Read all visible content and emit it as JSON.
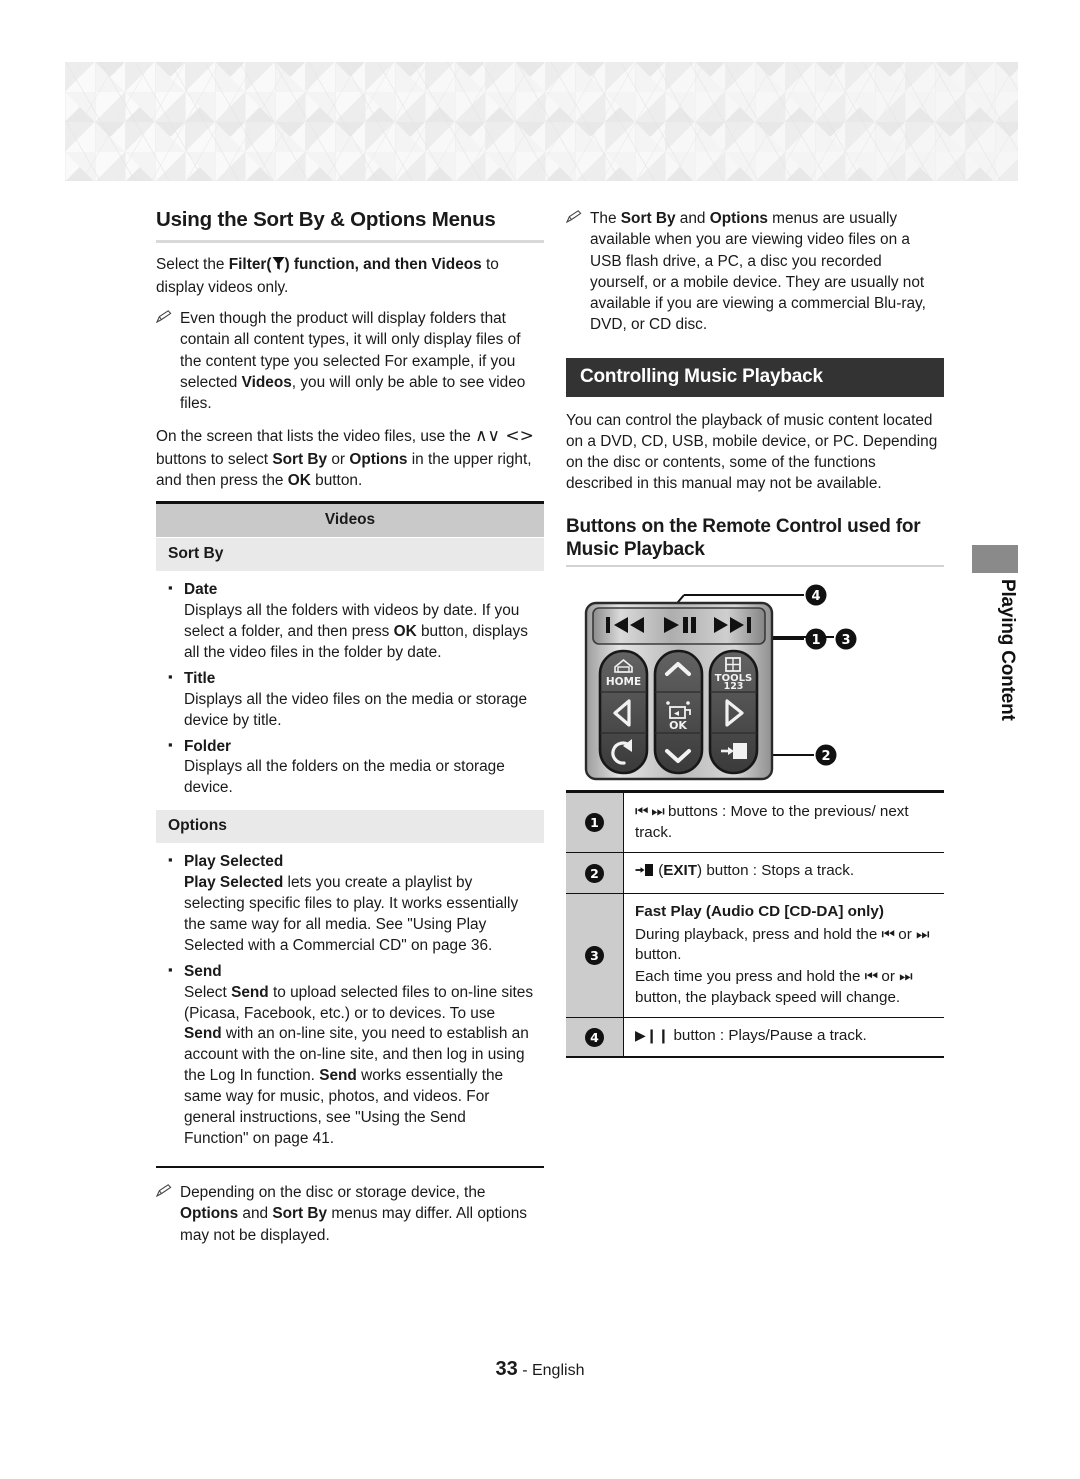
{
  "page": {
    "number": "33",
    "footer_separator": " - ",
    "language": "English",
    "side_tab_label": "Playing Content"
  },
  "left_column": {
    "heading": "Using the Sort By & Options Menus",
    "intro_parts": {
      "a": "Select the ",
      "b_filter": "Filter(",
      "filter_icon": "funnel-icon",
      "c": ") function, and then ",
      "d_videos": "Videos",
      "e": " to display videos only."
    },
    "note_1": {
      "icon": "pencil-note-icon",
      "text": "Even though the product will display folders that contain all content types, it will only display files of the content type you selected For example, if you selected Videos, you will only be able to see video files.",
      "bold_terms": [
        "Videos"
      ]
    },
    "paragraph_2_parts": {
      "a": "On the screen that lists the video files, use the ",
      "arrows": "∧∨ <>",
      "b": " buttons to select ",
      "c_sortby": "Sort By",
      "d": " or ",
      "e_options": "Options",
      "f": " in the upper right, and then press the ",
      "g_ok": "OK",
      "h": " button."
    },
    "table": {
      "title": "Videos",
      "groups": [
        {
          "label": "Sort By",
          "items": [
            {
              "term": "Date",
              "desc_a": "Displays all the folders with videos by date. If you select a folder, and then press ",
              "desc_bold": "OK",
              "desc_b": " button, displays all the video files in the folder by date."
            },
            {
              "term": "Title",
              "desc_a": "Displays all the video files on the media or storage device by title.",
              "desc_bold": "",
              "desc_b": ""
            },
            {
              "term": "Folder",
              "desc_a": "Displays all the folders on the media or storage device.",
              "desc_bold": "",
              "desc_b": ""
            }
          ]
        },
        {
          "label": "Options",
          "items": [
            {
              "term": "Play Selected",
              "desc_bold_lead": "Play Selected",
              "desc_a": " lets you create a playlist by selecting specific files to play. It works essentially the same way for all media. See \"Using Play Selected with a Commercial CD\" on page 36."
            },
            {
              "term": "Send",
              "desc_lead": "Select ",
              "desc_bold_1": "Send",
              "desc_2": " to upload selected files to on-line sites (Picasa, Facebook, etc.) or to devices. To use ",
              "desc_bold_2": "Send",
              "desc_3": " with an on-line site, you need to establish an account with the on-line site, and then log in using the Log In function. ",
              "desc_bold_3": "Send",
              "desc_4": " works essentially the same way for music, photos, and videos. For general instructions, see \"Using the Send Function\" on page 41."
            }
          ]
        }
      ]
    },
    "note_2": {
      "icon": "pencil-note-icon",
      "a": "Depending on the disc or storage device, the ",
      "bold_1": "Options",
      "b": " and ",
      "bold_2": "Sort By",
      "c": " menus may differ. All options may not be displayed."
    }
  },
  "right_column": {
    "note_1": {
      "icon": "pencil-note-icon",
      "a": "The ",
      "bold_1": "Sort By",
      "b": " and ",
      "bold_2": "Options",
      "c": " menus are usually available when you are viewing video files on a USB flash drive, a PC, a disc you recorded yourself, or a mobile device. They are usually not available if you are viewing a commercial Blu-ray, DVD, or CD disc."
    },
    "section_bar_title": "Controlling Music Playback",
    "paragraph": "You can control the playback of music content located on a DVD, CD, USB, mobile device, or PC. Depending on the disc or contents, some of the functions described in this manual may not be available.",
    "subheading": "Buttons on the Remote Control used for Music Playback",
    "remote": {
      "name": "remote-control-diagram",
      "callouts": [
        "1",
        "2",
        "3",
        "4"
      ],
      "buttons": {
        "prev": "skip-previous-icon",
        "play_pause": "play-pause-icon",
        "next": "skip-next-icon",
        "home_label": "HOME",
        "tools_label": "TOOLS",
        "tools_sub": "123",
        "ok_label": "OK",
        "up": "arrow-up-icon",
        "down": "arrow-down-icon",
        "left": "arrow-left-icon",
        "right": "arrow-right-icon",
        "return": "return-icon",
        "exit": "exit-icon"
      }
    },
    "button_table": [
      {
        "num": "1",
        "glyphs": "⏮ ⏭",
        "text": " buttons : Move to the previous/ next track."
      },
      {
        "num": "2",
        "glyphs": "",
        "exit_icon": "exit-icon",
        "text_a": " (",
        "bold": "EXIT",
        "text_b": ") button : Stops a track."
      },
      {
        "num": "3",
        "title": "Fast Play (Audio CD [CD-DA] only)",
        "line_1a": "During playback, press and hold the ",
        "g1": "⏮",
        "line_1b": " or ",
        "g2": "⏭",
        "line_1c": " button.",
        "line_2a": "Each time you press and hold the ",
        "g3": "⏮",
        "line_2b": " or ",
        "g4": "⏭",
        "line_2c": " button, the playback speed will change."
      },
      {
        "num": "4",
        "glyphs": "▶❙❙",
        "text": " button : Plays/Pause a track."
      }
    ]
  },
  "colors": {
    "bar_bg": "#333333",
    "table_header_bg": "#c9c9c9",
    "table_group_bg": "#e9e9e9",
    "num_col_bg": "#cccccc",
    "side_tab_cap": "#8a8a8a",
    "rule": "#d9d9d9"
  }
}
